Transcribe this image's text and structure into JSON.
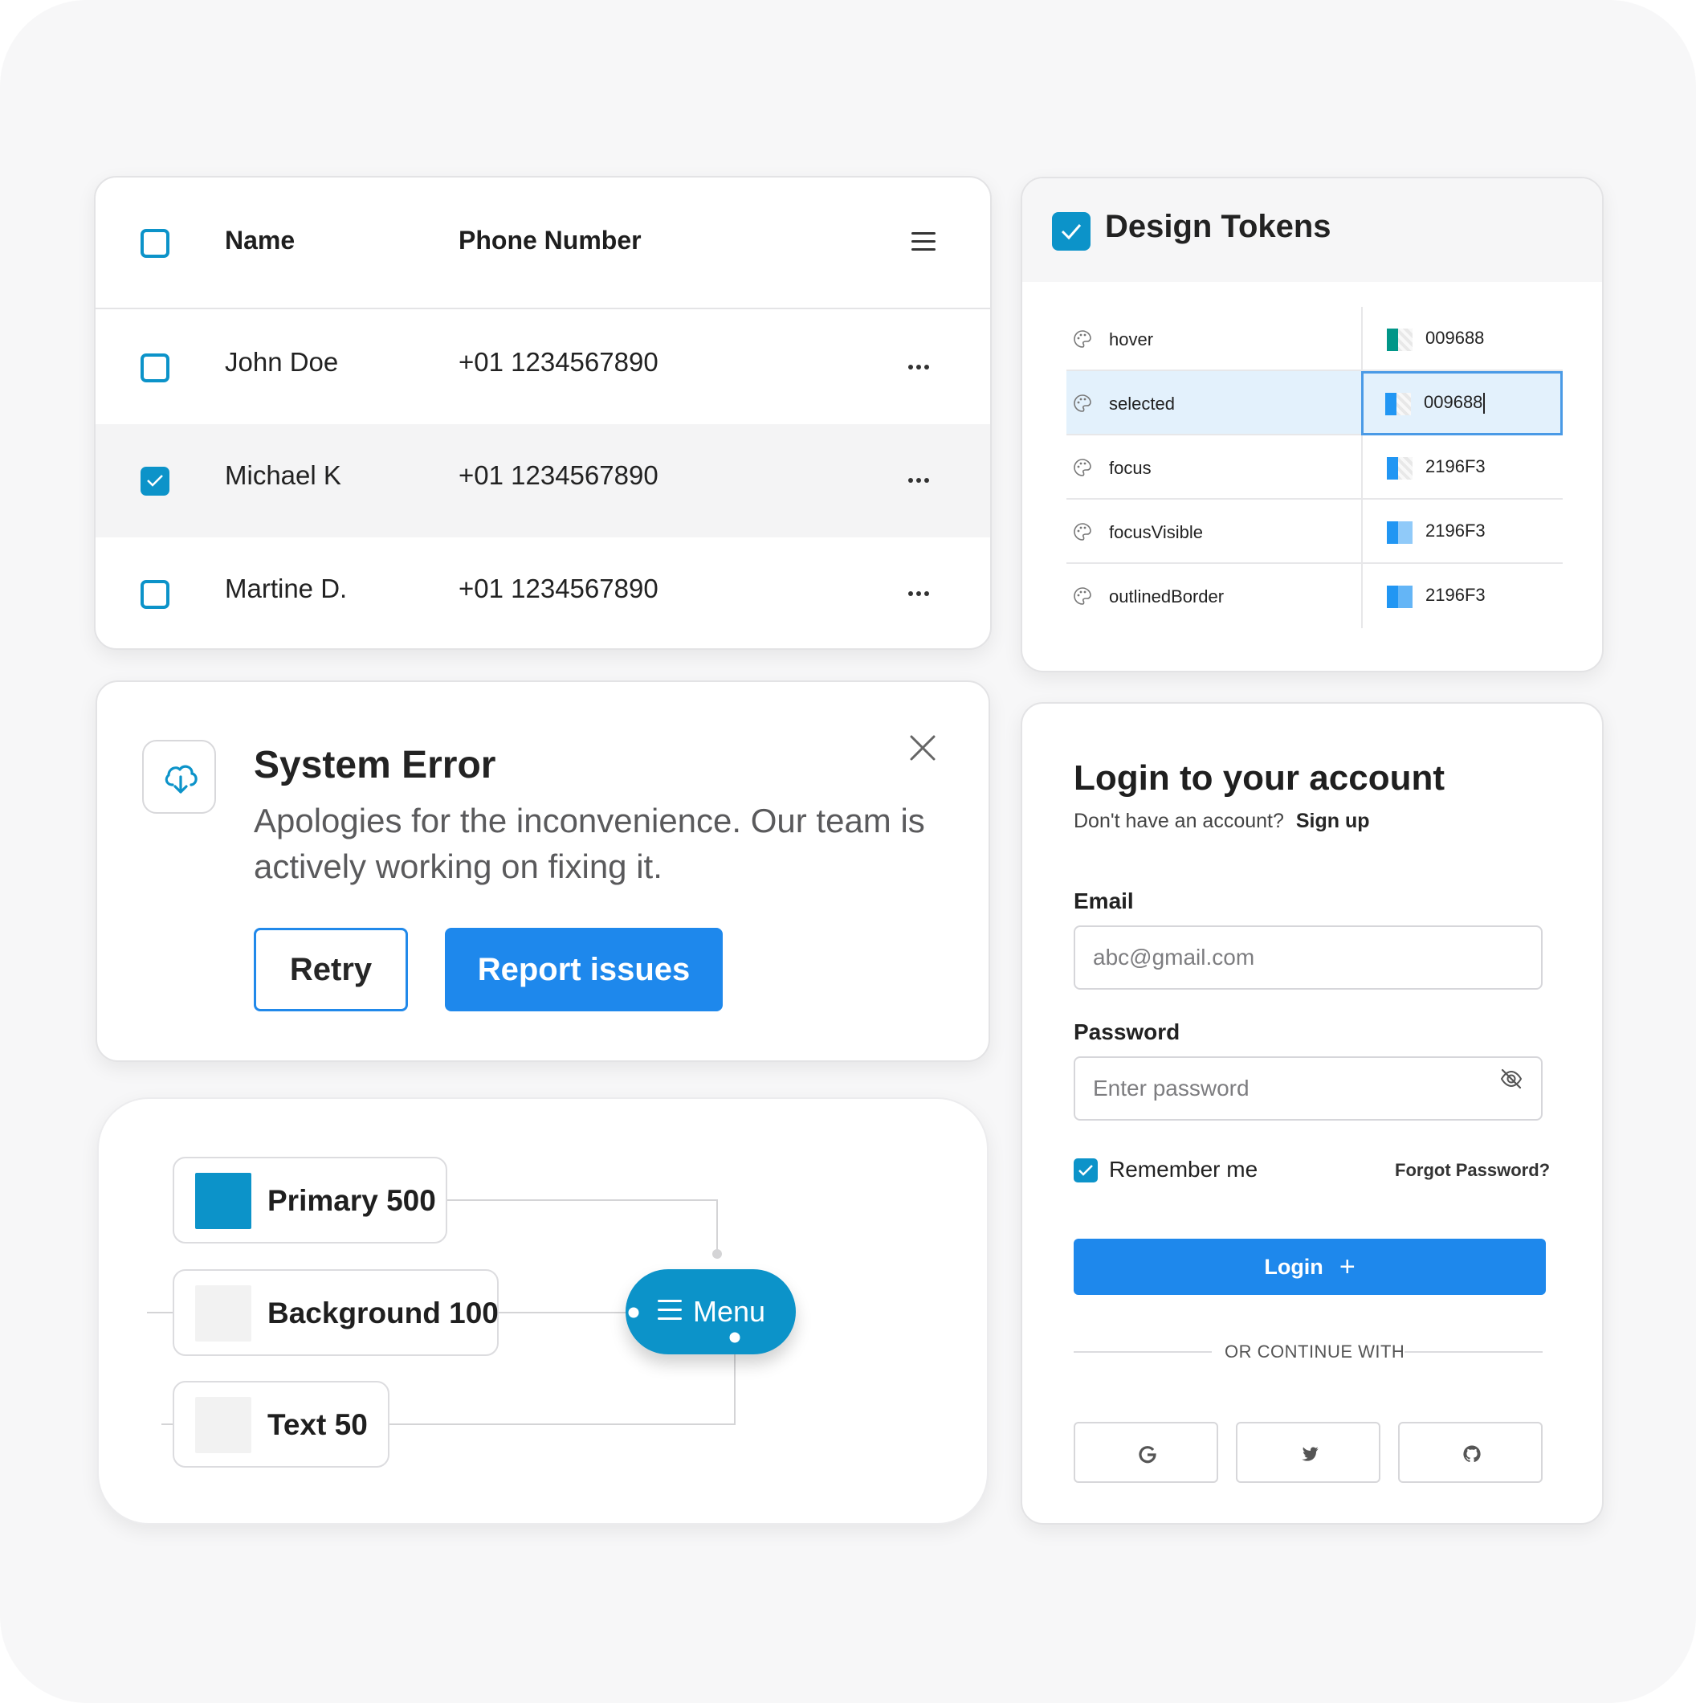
{
  "table": {
    "headers": {
      "name": "Name",
      "phone": "Phone Number"
    },
    "rows": [
      {
        "name": "John Doe",
        "phone": "+01 1234567890",
        "checked": false
      },
      {
        "name": "Michael K",
        "phone": "+01 1234567890",
        "checked": true
      },
      {
        "name": "Martine D.",
        "phone": "+01 1234567890",
        "checked": false
      }
    ]
  },
  "error": {
    "title": "System Error",
    "message": "Apologies for the inconvenience. Our team is actively working on fixing it.",
    "retry_label": "Retry",
    "report_label": "Report issues"
  },
  "flow": {
    "items": [
      {
        "label": "Primary 500",
        "color": "#0C93C9"
      },
      {
        "label": "Background 100",
        "color": "#F2F2F2"
      },
      {
        "label": "Text 50",
        "color": "#F2F2F2"
      }
    ],
    "menu_label": "Menu"
  },
  "tokens": {
    "title": "Design Tokens",
    "rows": [
      {
        "name": "hover",
        "value": "009688",
        "color": "#009688"
      },
      {
        "name": "selected",
        "value": "009688",
        "color": "#2196F3"
      },
      {
        "name": "focus",
        "value": "2196F3",
        "color": "#2196F3"
      },
      {
        "name": "focusVisible",
        "value": "2196F3",
        "color": "#2196F3"
      },
      {
        "name": "outlinedBorder",
        "value": "2196F3",
        "color": "#2196F3"
      }
    ]
  },
  "login": {
    "title": "Login to your account",
    "no_account": "Don't have an account?",
    "signup_label": "Sign up",
    "email_label": "Email",
    "email_placeholder": "abc@gmail.com",
    "password_label": "Password",
    "password_placeholder": "Enter password",
    "remember_label": "Remember me",
    "forgot_label": "Forgot Password?",
    "login_label": "Login",
    "divider_text": "OR CONTINUE WITH",
    "social": [
      "google-icon",
      "twitter-icon",
      "github-icon"
    ]
  },
  "colors": {
    "primary": "#0C93C9",
    "accent": "#1E88EC"
  }
}
